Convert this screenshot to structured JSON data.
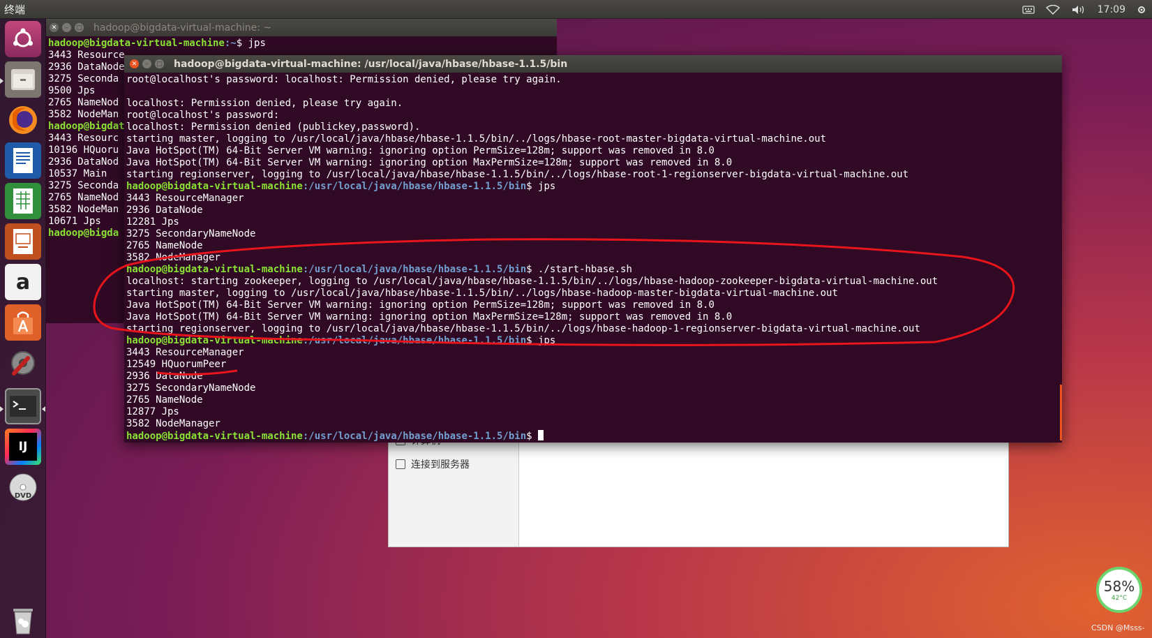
{
  "top_panel": {
    "app_title": "终端",
    "clock": "17:09",
    "icons": [
      "keyboard-icon",
      "wifi-icon",
      "volume-icon"
    ]
  },
  "launcher": {
    "items": [
      "ubuntu-dash",
      "files",
      "firefox",
      "libreoffice-writer",
      "libreoffice-calc",
      "libreoffice-impress",
      "amazon",
      "ubuntu-software",
      "system-settings",
      "terminal",
      "intellij-idea",
      "dvd",
      "trash"
    ],
    "labels": {
      "amazon": "a",
      "intellij": "IJ",
      "dvd": "DVD"
    }
  },
  "file_manager": {
    "items": [
      "计算机",
      "连接到服务器"
    ]
  },
  "terminal_back": {
    "title": "hadoop@bigdata-virtual-machine: ~",
    "user": "hadoop@bigdata-virtual-machine",
    "lines": [
      {
        "prompt": true,
        "path": "~",
        "cmd": " jps"
      },
      {
        "text": "3443 Resource"
      },
      {
        "text": "2936 DataNode"
      },
      {
        "text": "3275 Seconda"
      },
      {
        "text": "9500 Jps"
      },
      {
        "text": "2765 NameNod"
      },
      {
        "text": "3582 NodeMan"
      },
      {
        "prompt_partial": "hadoop@bigdat"
      },
      {
        "text": "3443 Resourc"
      },
      {
        "text": "10196 HQuoru"
      },
      {
        "text": "2936 DataNod"
      },
      {
        "text": "10537 Main"
      },
      {
        "text": "3275 Seconda"
      },
      {
        "text": "2765 NameNod"
      },
      {
        "text": "3582 NodeMan"
      },
      {
        "text": "10671 Jps"
      },
      {
        "prompt_partial": "hadoop@bigda"
      }
    ]
  },
  "terminal_front": {
    "title": "hadoop@bigdata-virtual-machine: /usr/local/java/hbase/hbase-1.1.5/bin",
    "user": "hadoop@bigdata-virtual-machine",
    "path": ":/usr/local/java/hbase/hbase-1.1.5/bin",
    "lines": [
      {
        "text": "root@localhost's password: localhost: Permission denied, please try again."
      },
      {
        "text": ""
      },
      {
        "text": "localhost: Permission denied, please try again."
      },
      {
        "text": "root@localhost's password:"
      },
      {
        "text": "localhost: Permission denied (publickey,password)."
      },
      {
        "text": "starting master, logging to /usr/local/java/hbase/hbase-1.1.5/bin/../logs/hbase-root-master-bigdata-virtual-machine.out"
      },
      {
        "text": "Java HotSpot(TM) 64-Bit Server VM warning: ignoring option PermSize=128m; support was removed in 8.0"
      },
      {
        "text": "Java HotSpot(TM) 64-Bit Server VM warning: ignoring option MaxPermSize=128m; support was removed in 8.0"
      },
      {
        "text": "starting regionserver, logging to /usr/local/java/hbase/hbase-1.1.5/bin/../logs/hbase-root-1-regionserver-bigdata-virtual-machine.out"
      },
      {
        "prompt": true,
        "cmd": " jps"
      },
      {
        "text": "3443 ResourceManager"
      },
      {
        "text": "2936 DataNode"
      },
      {
        "text": "12281 Jps"
      },
      {
        "text": "3275 SecondaryNameNode"
      },
      {
        "text": "2765 NameNode"
      },
      {
        "text": "3582 NodeManager"
      },
      {
        "prompt": true,
        "cmd": " ./start-hbase.sh"
      },
      {
        "text": "localhost: starting zookeeper, logging to /usr/local/java/hbase/hbase-1.1.5/bin/../logs/hbase-hadoop-zookeeper-bigdata-virtual-machine.out"
      },
      {
        "text": "starting master, logging to /usr/local/java/hbase/hbase-1.1.5/bin/../logs/hbase-hadoop-master-bigdata-virtual-machine.out"
      },
      {
        "text": "Java HotSpot(TM) 64-Bit Server VM warning: ignoring option PermSize=128m; support was removed in 8.0"
      },
      {
        "text": "Java HotSpot(TM) 64-Bit Server VM warning: ignoring option MaxPermSize=128m; support was removed in 8.0"
      },
      {
        "text": "starting regionserver, logging to /usr/local/java/hbase/hbase-1.1.5/bin/../logs/hbase-hadoop-1-regionserver-bigdata-virtual-machine.out"
      },
      {
        "prompt": true,
        "cmd": " jps"
      },
      {
        "text": "3443 ResourceManager"
      },
      {
        "text": "12549 HQuorumPeer"
      },
      {
        "text": "2936 DataNode"
      },
      {
        "text": "3275 SecondaryNameNode"
      },
      {
        "text": "2765 NameNode"
      },
      {
        "text": "12877 Jps"
      },
      {
        "text": "3582 NodeManager"
      },
      {
        "prompt": true,
        "cmd": " ",
        "cursor": true
      }
    ]
  },
  "monitor": {
    "percent": "58%",
    "temp": "42°C"
  },
  "watermark": "CSDN @Msss-",
  "colors": {
    "terminal_bg": "#300a24",
    "prompt_user": "#8ae234",
    "prompt_path": "#729fcf",
    "annotation": "#e8141c"
  }
}
